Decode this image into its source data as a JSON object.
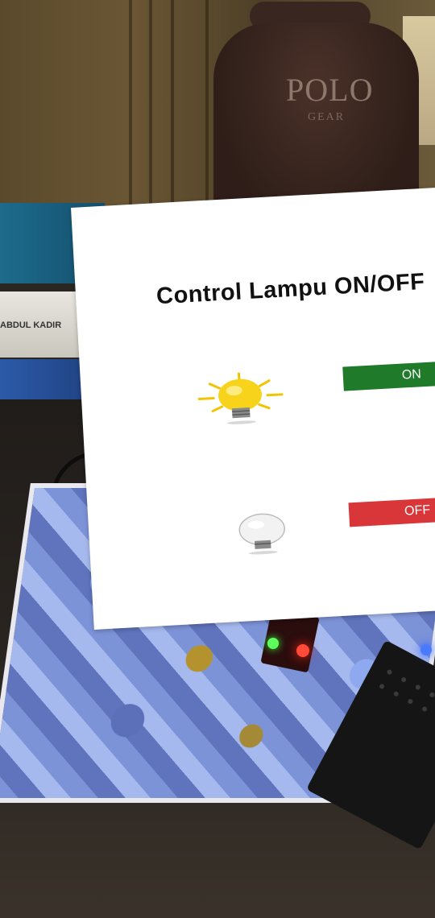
{
  "background": {
    "bag_logo": "POLO",
    "bag_logo_sub": "GEAR",
    "book_label": "ABDUL KADIR"
  },
  "panel": {
    "title": "Control Lampu ON/OFF"
  },
  "buttons": {
    "on": {
      "label": "ON",
      "color": "#1f7a2a"
    },
    "off": {
      "label": "OFF",
      "color": "#d9363a"
    }
  },
  "icons": {
    "bulb_on": "lightbulb-on-icon",
    "bulb_off": "lightbulb-off-icon"
  }
}
